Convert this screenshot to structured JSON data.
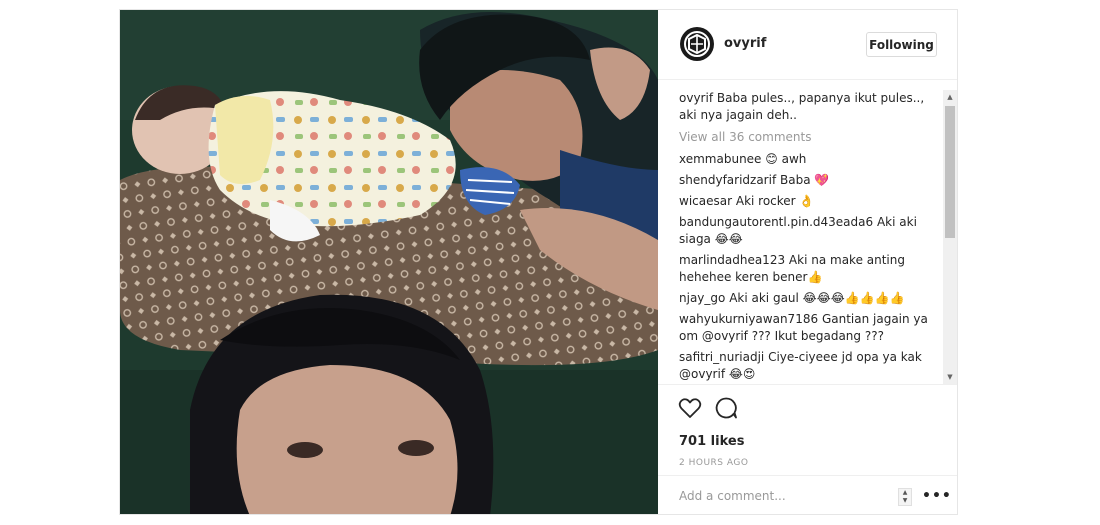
{
  "post": {
    "username": "ovyrif",
    "follow_label": "Following",
    "caption": {
      "user": "ovyrif",
      "text": "Baba pules.., papanya ikut pules.., aki nya jagain deh.."
    },
    "view_all_label": "View all 36 comments",
    "comments": [
      {
        "user": "xemmabunee",
        "text": "😊 awh"
      },
      {
        "user": "shendyfaridzarif",
        "text": "Baba 💖"
      },
      {
        "user": "wicaesar",
        "text": "Aki rocker 👌"
      },
      {
        "user": "bandungautorentl.pin.d43eada6",
        "text": "Aki aki siaga 😂😂"
      },
      {
        "user": "marlindadhea123",
        "text": "Aki na make anting hehehee keren bener👍"
      },
      {
        "user": "njay_go",
        "text": "Aki aki gaul 😂😂😂👍👍👍👍"
      },
      {
        "user": "wahyukurniyawan7186",
        "text": "Gantian jagain ya om @ovyrif ??? Ikut begadang ???"
      },
      {
        "user": "safitri_nuriadji",
        "text": "Ciye-ciyeee jd opa ya kak @ovyrif 😂😍"
      }
    ],
    "likes_label": "701 likes",
    "time_label": "2 HOURS AGO",
    "add_comment_placeholder": "Add a comment...",
    "more_label": "•••"
  },
  "icons": {
    "like": "heart-icon",
    "comment": "comment-bubble-icon",
    "avatar": "profile-logo"
  },
  "colors": {
    "text": "#262626",
    "muted": "#999999",
    "border": "#e6e6e6"
  }
}
